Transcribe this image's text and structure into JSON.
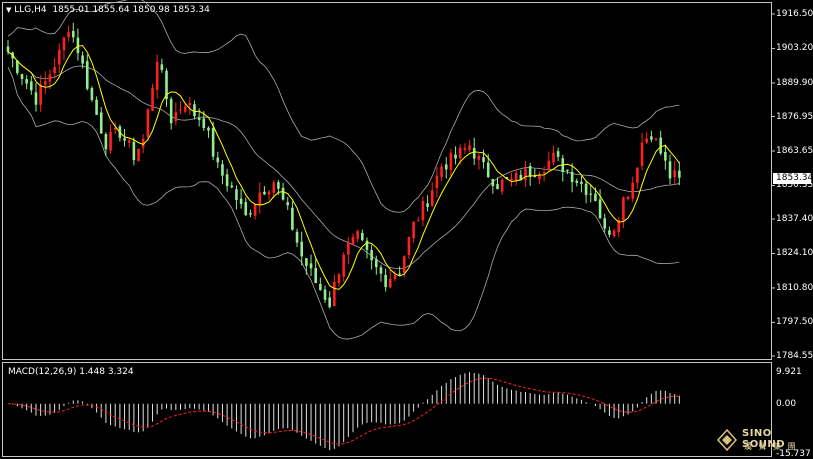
{
  "header": {
    "symbol": "LLG,H4",
    "ohlc": "1855.01 1855.64 1850.98 1853.34",
    "menu_icon": "triangle-down-icon"
  },
  "macd": {
    "title": "MACD(12,26,9) 1.448 3.324",
    "ticks": [
      "9.921",
      "0.00",
      "-15.737"
    ]
  },
  "price_axis": {
    "ticks": [
      "1916.50",
      "1903.20",
      "1889.90",
      "1876.95",
      "1863.65",
      "1850.35",
      "1837.40",
      "1824.10",
      "1810.80",
      "1797.50",
      "1784.55"
    ],
    "current_price": "1853.34"
  },
  "logo": {
    "name": "SINO SOUND",
    "sub": "漢 聲 集 團"
  },
  "colors": {
    "up": "#ff2020",
    "down": "#90ee90",
    "ma": "#ffff00",
    "band": "#aaaaaa",
    "signal": "#ff2020"
  },
  "chart_data": {
    "type": "candlestick",
    "title": "LLG,H4",
    "ylim": [
      1784.55,
      1916.5
    ],
    "indicators": [
      "Bollinger Bands",
      "Moving Average",
      "MACD(12,26,9)"
    ],
    "anchors": [
      [
        0,
        1902
      ],
      [
        3,
        1893
      ],
      [
        6,
        1884
      ],
      [
        8,
        1890
      ],
      [
        11,
        1901
      ],
      [
        13,
        1912
      ],
      [
        15,
        1903
      ],
      [
        18,
        1883
      ],
      [
        21,
        1867
      ],
      [
        24,
        1871
      ],
      [
        27,
        1862
      ],
      [
        29,
        1868
      ],
      [
        32,
        1900
      ],
      [
        35,
        1876
      ],
      [
        38,
        1883
      ],
      [
        40,
        1878
      ],
      [
        42,
        1875
      ],
      [
        45,
        1857
      ],
      [
        48,
        1849
      ],
      [
        51,
        1838
      ],
      [
        54,
        1848
      ],
      [
        57,
        1852
      ],
      [
        60,
        1840
      ],
      [
        63,
        1823
      ],
      [
        66,
        1813
      ],
      [
        69,
        1805
      ],
      [
        72,
        1825
      ],
      [
        75,
        1830
      ],
      [
        78,
        1820
      ],
      [
        81,
        1814
      ],
      [
        84,
        1818
      ],
      [
        87,
        1835
      ],
      [
        90,
        1845
      ],
      [
        93,
        1858
      ],
      [
        96,
        1861
      ],
      [
        99,
        1866
      ],
      [
        102,
        1857
      ],
      [
        105,
        1851
      ],
      [
        108,
        1852
      ],
      [
        111,
        1855
      ],
      [
        114,
        1857
      ],
      [
        117,
        1861
      ],
      [
        120,
        1856
      ],
      [
        123,
        1851
      ],
      [
        126,
        1846
      ],
      [
        128,
        1832
      ],
      [
        130,
        1835
      ],
      [
        132,
        1845
      ],
      [
        134,
        1852
      ],
      [
        136,
        1867
      ],
      [
        138,
        1871
      ],
      [
        140,
        1863
      ],
      [
        142,
        1854
      ],
      [
        144,
        1853.34
      ]
    ]
  }
}
